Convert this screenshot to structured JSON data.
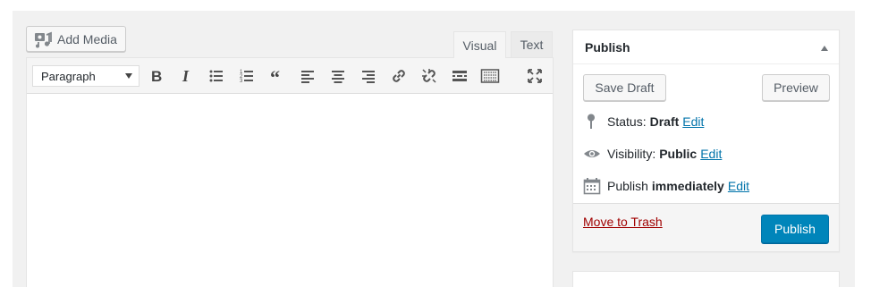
{
  "media": {
    "add_media_label": "Add Media"
  },
  "editor": {
    "tabs": [
      {
        "label": "Visual",
        "active": true
      },
      {
        "label": "Text",
        "active": false
      }
    ],
    "format_select": {
      "value": "Paragraph"
    },
    "toolbar_icons": [
      "bold-icon",
      "italic-icon",
      "bullet-list-icon",
      "numbered-list-icon",
      "blockquote-icon",
      "align-left-icon",
      "align-center-icon",
      "align-right-icon",
      "link-icon",
      "unlink-icon",
      "read-more-icon",
      "toolbar-toggle-icon",
      "fullscreen-icon"
    ]
  },
  "publish": {
    "title": "Publish",
    "save_draft_label": "Save Draft",
    "preview_label": "Preview",
    "status": {
      "label": "Status:",
      "value": "Draft",
      "edit": "Edit"
    },
    "visibility": {
      "label": "Visibility:",
      "value": "Public",
      "edit": "Edit"
    },
    "schedule": {
      "label": "Publish",
      "value": "immediately",
      "edit": "Edit"
    },
    "trash_label": "Move to Trash",
    "publish_label": "Publish"
  },
  "colors": {
    "primary": "#0085ba",
    "link": "#0073aa",
    "trash": "#a00000",
    "admin_bg": "#f1f1f1"
  }
}
